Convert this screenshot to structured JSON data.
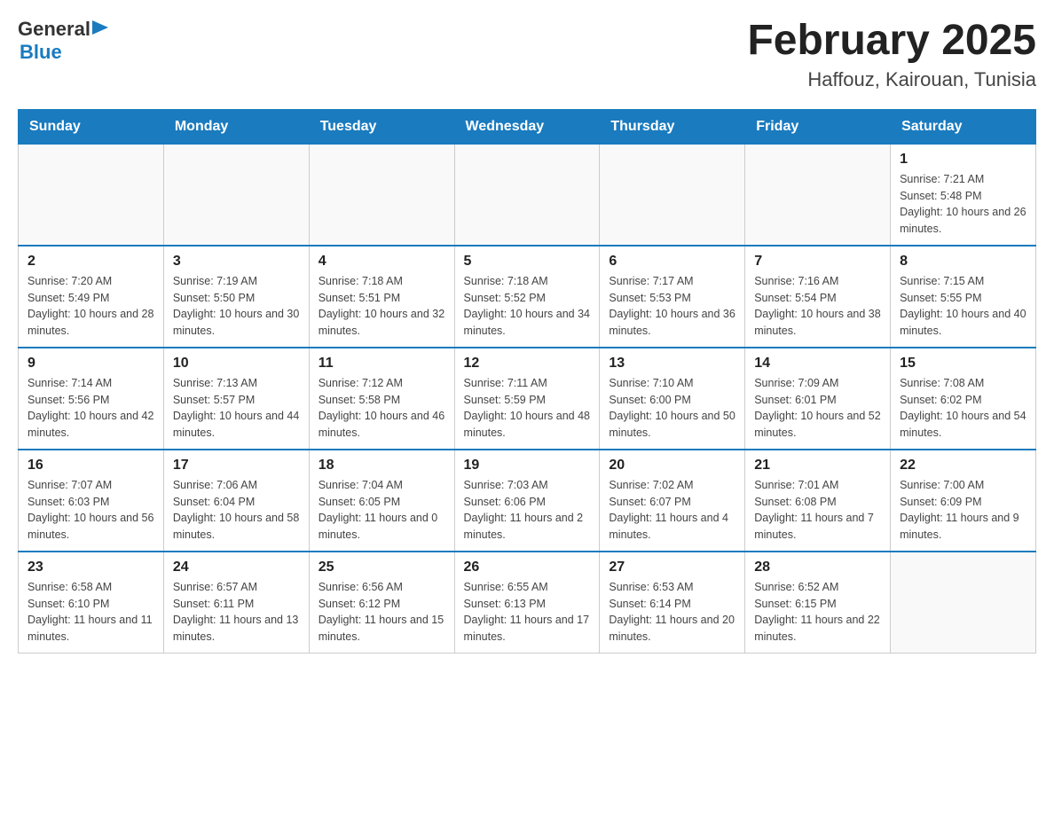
{
  "header": {
    "logo_general": "General",
    "logo_blue": "Blue",
    "month_title": "February 2025",
    "location": "Haffouz, Kairouan, Tunisia"
  },
  "days_of_week": [
    "Sunday",
    "Monday",
    "Tuesday",
    "Wednesday",
    "Thursday",
    "Friday",
    "Saturday"
  ],
  "weeks": [
    [
      {
        "day": "",
        "info": ""
      },
      {
        "day": "",
        "info": ""
      },
      {
        "day": "",
        "info": ""
      },
      {
        "day": "",
        "info": ""
      },
      {
        "day": "",
        "info": ""
      },
      {
        "day": "",
        "info": ""
      },
      {
        "day": "1",
        "info": "Sunrise: 7:21 AM\nSunset: 5:48 PM\nDaylight: 10 hours and 26 minutes."
      }
    ],
    [
      {
        "day": "2",
        "info": "Sunrise: 7:20 AM\nSunset: 5:49 PM\nDaylight: 10 hours and 28 minutes."
      },
      {
        "day": "3",
        "info": "Sunrise: 7:19 AM\nSunset: 5:50 PM\nDaylight: 10 hours and 30 minutes."
      },
      {
        "day": "4",
        "info": "Sunrise: 7:18 AM\nSunset: 5:51 PM\nDaylight: 10 hours and 32 minutes."
      },
      {
        "day": "5",
        "info": "Sunrise: 7:18 AM\nSunset: 5:52 PM\nDaylight: 10 hours and 34 minutes."
      },
      {
        "day": "6",
        "info": "Sunrise: 7:17 AM\nSunset: 5:53 PM\nDaylight: 10 hours and 36 minutes."
      },
      {
        "day": "7",
        "info": "Sunrise: 7:16 AM\nSunset: 5:54 PM\nDaylight: 10 hours and 38 minutes."
      },
      {
        "day": "8",
        "info": "Sunrise: 7:15 AM\nSunset: 5:55 PM\nDaylight: 10 hours and 40 minutes."
      }
    ],
    [
      {
        "day": "9",
        "info": "Sunrise: 7:14 AM\nSunset: 5:56 PM\nDaylight: 10 hours and 42 minutes."
      },
      {
        "day": "10",
        "info": "Sunrise: 7:13 AM\nSunset: 5:57 PM\nDaylight: 10 hours and 44 minutes."
      },
      {
        "day": "11",
        "info": "Sunrise: 7:12 AM\nSunset: 5:58 PM\nDaylight: 10 hours and 46 minutes."
      },
      {
        "day": "12",
        "info": "Sunrise: 7:11 AM\nSunset: 5:59 PM\nDaylight: 10 hours and 48 minutes."
      },
      {
        "day": "13",
        "info": "Sunrise: 7:10 AM\nSunset: 6:00 PM\nDaylight: 10 hours and 50 minutes."
      },
      {
        "day": "14",
        "info": "Sunrise: 7:09 AM\nSunset: 6:01 PM\nDaylight: 10 hours and 52 minutes."
      },
      {
        "day": "15",
        "info": "Sunrise: 7:08 AM\nSunset: 6:02 PM\nDaylight: 10 hours and 54 minutes."
      }
    ],
    [
      {
        "day": "16",
        "info": "Sunrise: 7:07 AM\nSunset: 6:03 PM\nDaylight: 10 hours and 56 minutes."
      },
      {
        "day": "17",
        "info": "Sunrise: 7:06 AM\nSunset: 6:04 PM\nDaylight: 10 hours and 58 minutes."
      },
      {
        "day": "18",
        "info": "Sunrise: 7:04 AM\nSunset: 6:05 PM\nDaylight: 11 hours and 0 minutes."
      },
      {
        "day": "19",
        "info": "Sunrise: 7:03 AM\nSunset: 6:06 PM\nDaylight: 11 hours and 2 minutes."
      },
      {
        "day": "20",
        "info": "Sunrise: 7:02 AM\nSunset: 6:07 PM\nDaylight: 11 hours and 4 minutes."
      },
      {
        "day": "21",
        "info": "Sunrise: 7:01 AM\nSunset: 6:08 PM\nDaylight: 11 hours and 7 minutes."
      },
      {
        "day": "22",
        "info": "Sunrise: 7:00 AM\nSunset: 6:09 PM\nDaylight: 11 hours and 9 minutes."
      }
    ],
    [
      {
        "day": "23",
        "info": "Sunrise: 6:58 AM\nSunset: 6:10 PM\nDaylight: 11 hours and 11 minutes."
      },
      {
        "day": "24",
        "info": "Sunrise: 6:57 AM\nSunset: 6:11 PM\nDaylight: 11 hours and 13 minutes."
      },
      {
        "day": "25",
        "info": "Sunrise: 6:56 AM\nSunset: 6:12 PM\nDaylight: 11 hours and 15 minutes."
      },
      {
        "day": "26",
        "info": "Sunrise: 6:55 AM\nSunset: 6:13 PM\nDaylight: 11 hours and 17 minutes."
      },
      {
        "day": "27",
        "info": "Sunrise: 6:53 AM\nSunset: 6:14 PM\nDaylight: 11 hours and 20 minutes."
      },
      {
        "day": "28",
        "info": "Sunrise: 6:52 AM\nSunset: 6:15 PM\nDaylight: 11 hours and 22 minutes."
      },
      {
        "day": "",
        "info": ""
      }
    ]
  ]
}
